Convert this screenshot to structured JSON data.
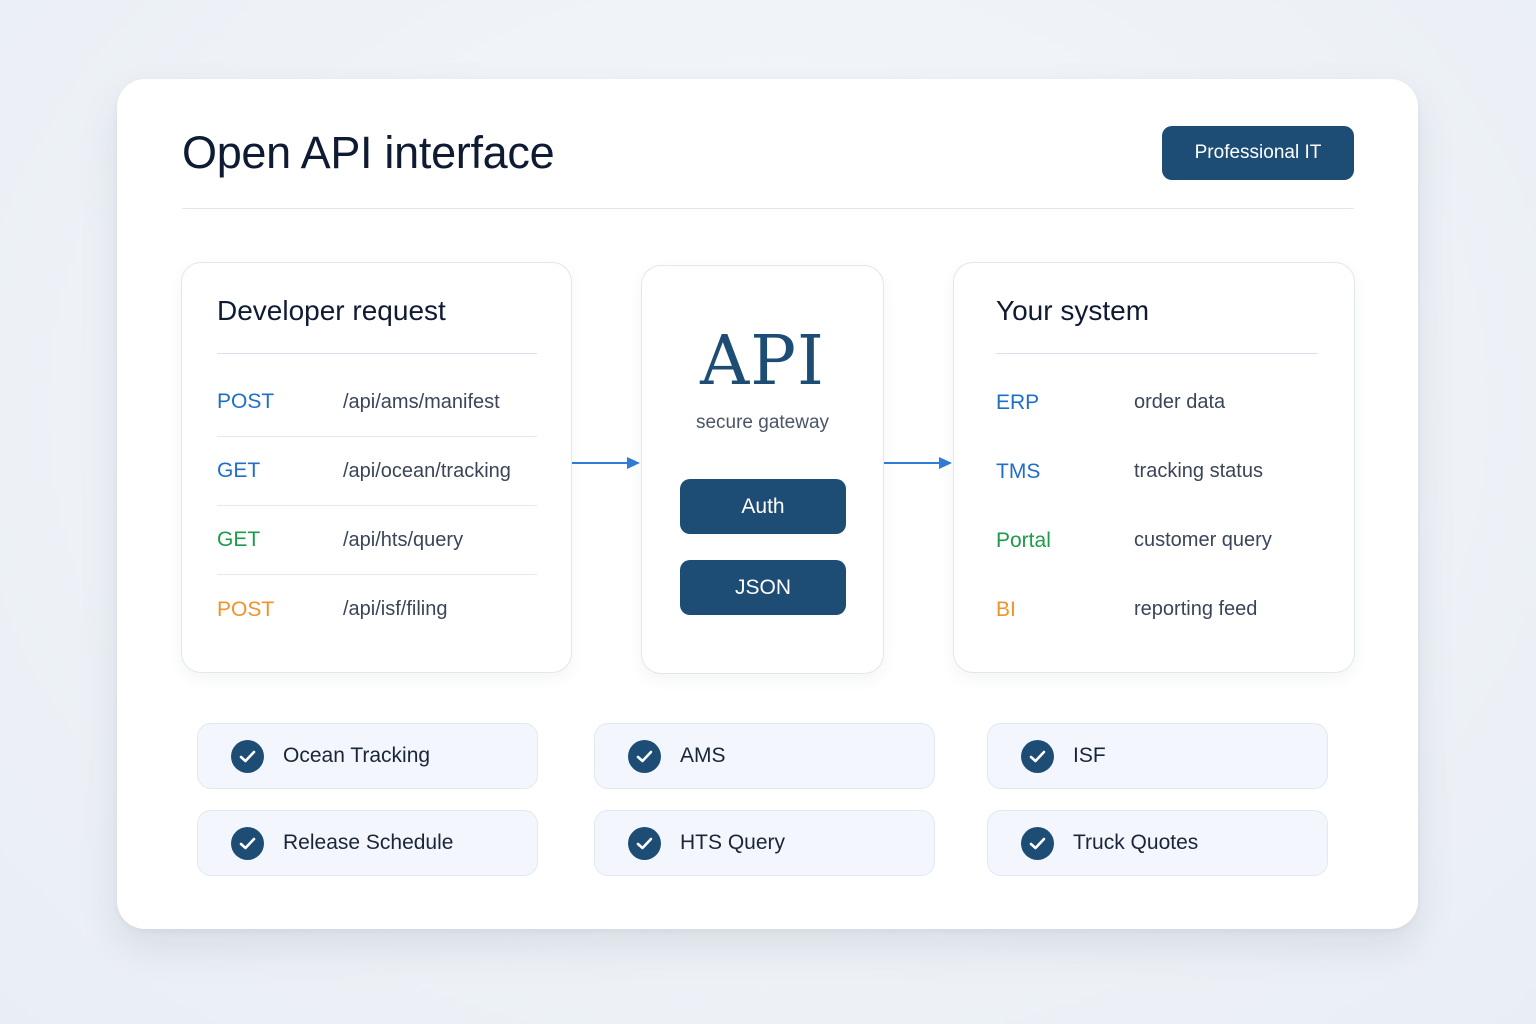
{
  "header": {
    "title": "Open API interface",
    "badge": "Professional IT"
  },
  "colors": {
    "navy": "#1d4c75",
    "blue": "#1f6fc9",
    "green": "#1f9a4c",
    "orange": "#f0932b",
    "arrow": "#2f7bd6"
  },
  "developer": {
    "title": "Developer request",
    "rows": [
      {
        "method": "POST",
        "path": "/api/ams/manifest",
        "color": "#1f6fc9"
      },
      {
        "method": "GET",
        "path": "/api/ocean/tracking",
        "color": "#1f6fc9"
      },
      {
        "method": "GET",
        "path": "/api/hts/query",
        "color": "#1f9a4c"
      },
      {
        "method": "POST",
        "path": "/api/isf/filing",
        "color": "#f0932b"
      }
    ]
  },
  "gateway": {
    "title": "API",
    "subtitle": "secure gateway",
    "buttons": [
      "Auth",
      "JSON"
    ]
  },
  "system": {
    "title": "Your system",
    "rows": [
      {
        "name": "ERP",
        "desc": "order data",
        "color": "#1f6fc9"
      },
      {
        "name": "TMS",
        "desc": "tracking status",
        "color": "#1f6fc9"
      },
      {
        "name": "Portal",
        "desc": "customer query",
        "color": "#1f9a4c"
      },
      {
        "name": "BI",
        "desc": "reporting feed",
        "color": "#f0932b"
      }
    ]
  },
  "features": [
    {
      "label": "Ocean Tracking",
      "icon": "check-circle-icon"
    },
    {
      "label": "AMS",
      "icon": "check-circle-icon"
    },
    {
      "label": "ISF",
      "icon": "check-circle-icon"
    },
    {
      "label": "Release Schedule",
      "icon": "check-circle-icon"
    },
    {
      "label": "HTS Query",
      "icon": "check-circle-icon"
    },
    {
      "label": "Truck Quotes",
      "icon": "check-circle-icon"
    }
  ]
}
